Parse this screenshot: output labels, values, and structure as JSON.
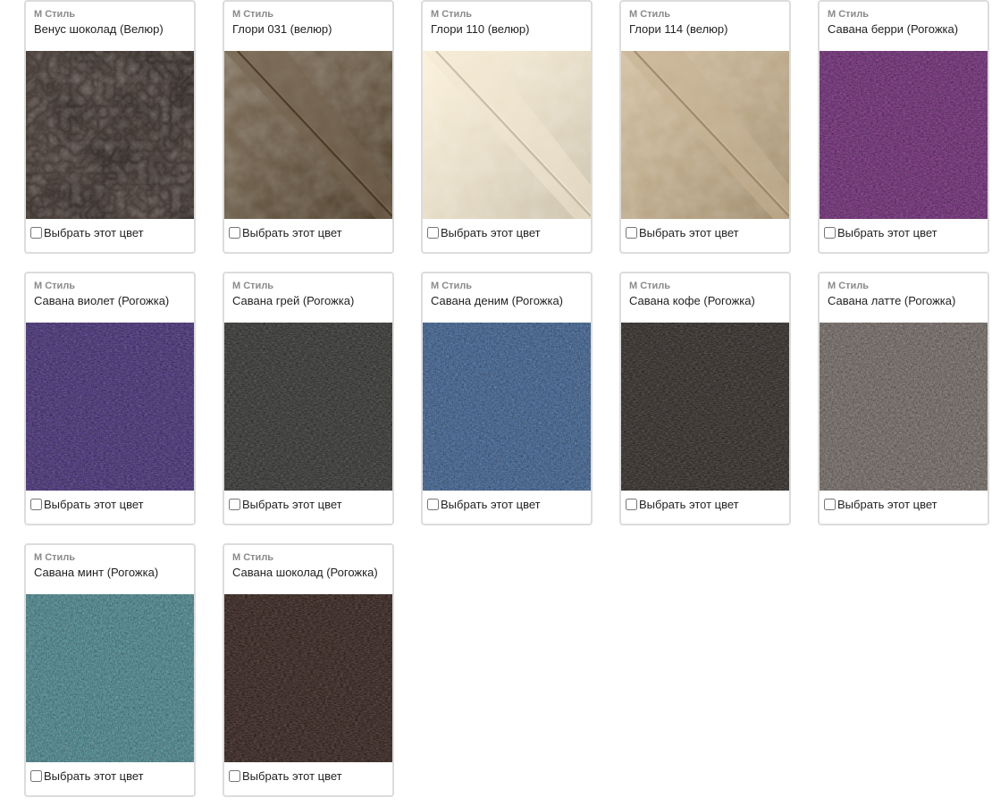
{
  "select_label": "Выбрать этот цвет",
  "items": [
    {
      "brand": "М Стиль",
      "name": "Венус шоколад (Велюр)",
      "color": "#4a3f3a",
      "texture": "leather"
    },
    {
      "brand": "М Стиль",
      "name": "Глори 031 (велюр)",
      "color": "#6a5b47",
      "texture": "velour"
    },
    {
      "brand": "М Стиль",
      "name": "Глори 110 (велюр)",
      "color": "#e6dcc6",
      "texture": "velour"
    },
    {
      "brand": "М Стиль",
      "name": "Глори 114 (велюр)",
      "color": "#bda98a",
      "texture": "velour"
    },
    {
      "brand": "М Стиль",
      "name": "Савана берри (Рогожка)",
      "color": "#7a3581",
      "texture": "weave"
    },
    {
      "brand": "М Стиль",
      "name": "Савана виолет (Рогожка)",
      "color": "#4f3a83",
      "texture": "weave"
    },
    {
      "brand": "М Стиль",
      "name": "Савана грей (Рогожка)",
      "color": "#3e3f3c",
      "texture": "weave"
    },
    {
      "brand": "М Стиль",
      "name": "Савана деним (Рогожка)",
      "color": "#4a6d9c",
      "texture": "weave"
    },
    {
      "brand": "М Стиль",
      "name": "Савана кофе (Рогожка)",
      "color": "#3a3430",
      "texture": "weave"
    },
    {
      "brand": "М Стиль",
      "name": "Савана латте (Рогожка)",
      "color": "#7e7570",
      "texture": "weave"
    },
    {
      "brand": "М Стиль",
      "name": "Савана минт (Рогожка)",
      "color": "#56939a",
      "texture": "weave"
    },
    {
      "brand": "М Стиль",
      "name": "Савана шоколад (Рогожка)",
      "color": "#3e2a25",
      "texture": "weave"
    }
  ]
}
